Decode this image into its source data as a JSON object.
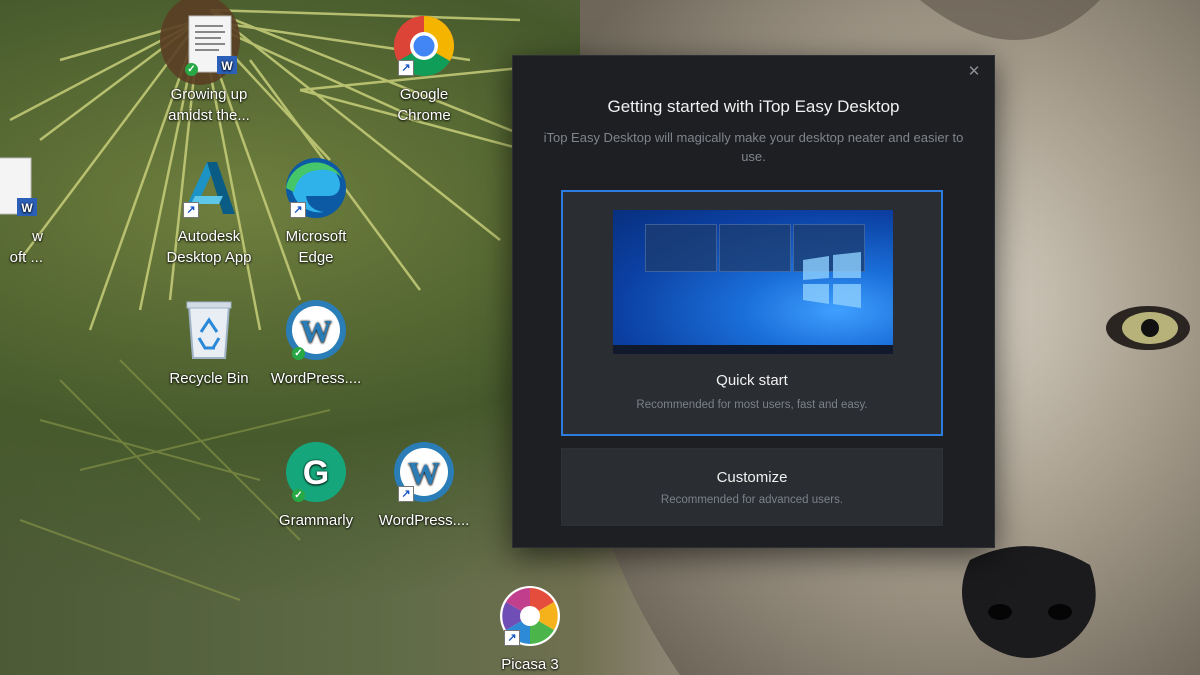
{
  "desktop": {
    "icons": [
      {
        "label": "Growing up\namidst the...",
        "icon": "word-document-icon",
        "badge": "synced"
      },
      {
        "label": "Google\nChrome",
        "icon": "chrome-icon",
        "badge": "shortcut"
      },
      {
        "label": "w\noft ...",
        "icon": "word-document-icon",
        "badge": "none"
      },
      {
        "label": "Autodesk\nDesktop App",
        "icon": "autodesk-icon",
        "badge": "shortcut"
      },
      {
        "label": "Microsoft\nEdge",
        "icon": "edge-icon",
        "badge": "shortcut"
      },
      {
        "label": "Recycle Bin",
        "icon": "recycle-bin-icon",
        "badge": "none"
      },
      {
        "label": "WordPress....",
        "icon": "wordpress-icon",
        "badge": "synced"
      },
      {
        "label": "Grammarly",
        "icon": "grammarly-icon",
        "badge": "synced"
      },
      {
        "label": "WordPress....",
        "icon": "wordpress-icon",
        "badge": "shortcut"
      },
      {
        "label": "Picasa 3",
        "icon": "picasa-icon",
        "badge": "shortcut"
      }
    ]
  },
  "dialog": {
    "title": "Getting started with iTop Easy Desktop",
    "subtitle": "iTop Easy Desktop will magically make your desktop neater and easier to use.",
    "close_symbol": "✕",
    "options": [
      {
        "title": "Quick start",
        "description": "Recommended for most users, fast and easy.",
        "selected": true
      },
      {
        "title": "Customize",
        "description": "Recommended for advanced users.",
        "selected": false
      }
    ]
  },
  "colors": {
    "dialog_bg": "#1d1f23",
    "card_bg": "#2a2d32",
    "accent": "#2f7ce0"
  }
}
